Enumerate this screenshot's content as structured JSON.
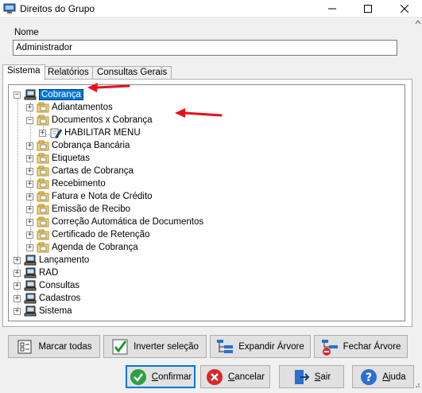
{
  "window": {
    "title": "Direitos do Grupo"
  },
  "form": {
    "nome_label": "Nome",
    "nome_value": "Administrador"
  },
  "tabs": [
    {
      "label": "Sistema",
      "active": true
    },
    {
      "label": "Relatórios",
      "active": false
    },
    {
      "label": "Consultas Gerais",
      "active": false
    }
  ],
  "tree": {
    "cobranca": {
      "label": "Cobrança",
      "expanded": true,
      "selected": true
    },
    "cobranca_children": [
      {
        "label": "Adiantamentos",
        "expander": "+"
      },
      {
        "label": "Documentos x Cobrança",
        "expander": "−"
      },
      {
        "label": "Cobrança Bancária",
        "expander": "+"
      },
      {
        "label": "Etiquetas",
        "expander": "+"
      },
      {
        "label": "Cartas de Cobrança",
        "expander": "+"
      },
      {
        "label": "Recebimento",
        "expander": "+"
      },
      {
        "label": "Fatura e Nota de Crédito",
        "expander": "+"
      },
      {
        "label": "Emissão de Recibo",
        "expander": "+"
      },
      {
        "label": "Correção Automática de Documentos",
        "expander": "+"
      },
      {
        "label": "Certificado de Retenção",
        "expander": "+"
      },
      {
        "label": "Agenda de Cobrança",
        "expander": "+"
      }
    ],
    "documentos_children": [
      {
        "label": "HABILITAR MENU"
      }
    ],
    "roots": [
      {
        "label": "Lançamento",
        "expander": "+"
      },
      {
        "label": "RAD",
        "expander": "+"
      },
      {
        "label": "Consultas",
        "expander": "+"
      },
      {
        "label": "Cadastros",
        "expander": "+"
      },
      {
        "label": "Sistema",
        "expander": "+"
      }
    ]
  },
  "actions": {
    "marcar_todas": "Marcar todas",
    "inverter_selecao": "Inverter seleção",
    "expandir_arvore": "Expandir Árvore",
    "fechar_arvore": "Fechar Árvore"
  },
  "footer": {
    "confirmar_first": "C",
    "confirmar_rest": "onfirmar",
    "cancelar_first": "C",
    "cancelar_rest": "ancelar",
    "sair_first": "S",
    "sair_rest": "air",
    "ajuda_first": "A",
    "ajuda_rest": "juda"
  },
  "colors": {
    "selection": "#0078d7",
    "annotation_arrow": "#e8101a",
    "folder": "#f0d57a"
  }
}
